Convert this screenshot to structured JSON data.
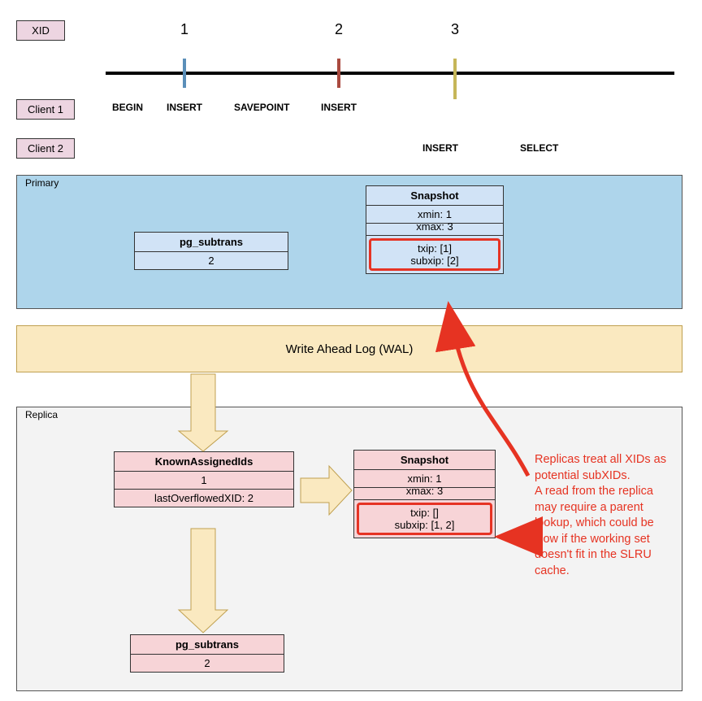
{
  "labels": {
    "xid": "XID",
    "client1": "Client 1",
    "client2": "Client 2"
  },
  "timeline": {
    "xids": {
      "n1": "1",
      "n2": "2",
      "n3": "3"
    },
    "client1": {
      "begin": "BEGIN",
      "insert1": "INSERT",
      "savepoint": "SAVEPOINT",
      "insert2": "INSERT"
    },
    "client2": {
      "insert": "INSERT",
      "select": "SELECT"
    }
  },
  "primary": {
    "title": "Primary",
    "pg_subtrans": {
      "title": "pg_subtrans",
      "row": "2"
    },
    "snapshot": {
      "title": "Snapshot",
      "xmin": "xmin: 1",
      "xmax": "xmax: 3",
      "txip": "txip: [1]",
      "subxip": "subxip: [2]"
    }
  },
  "wal": {
    "label": "Write Ahead Log (WAL)"
  },
  "replica": {
    "title": "Replica",
    "known": {
      "title": "KnownAssignedIds",
      "row1": "1",
      "row2": "lastOverflowedXID: 2"
    },
    "snapshot": {
      "title": "Snapshot",
      "xmin": "xmin: 1",
      "xmax": "xmax: 3",
      "txip": "txip: []",
      "subxip": "subxip: [1, 2]"
    },
    "pg_subtrans": {
      "title": "pg_subtrans",
      "row": "2"
    }
  },
  "annotation": {
    "text": "Replicas treat all XIDs as potential subXIDs.\nA read from the replica may require a parent lookup, which could be slow if the working set doesn't fit in the SLRU cache."
  }
}
